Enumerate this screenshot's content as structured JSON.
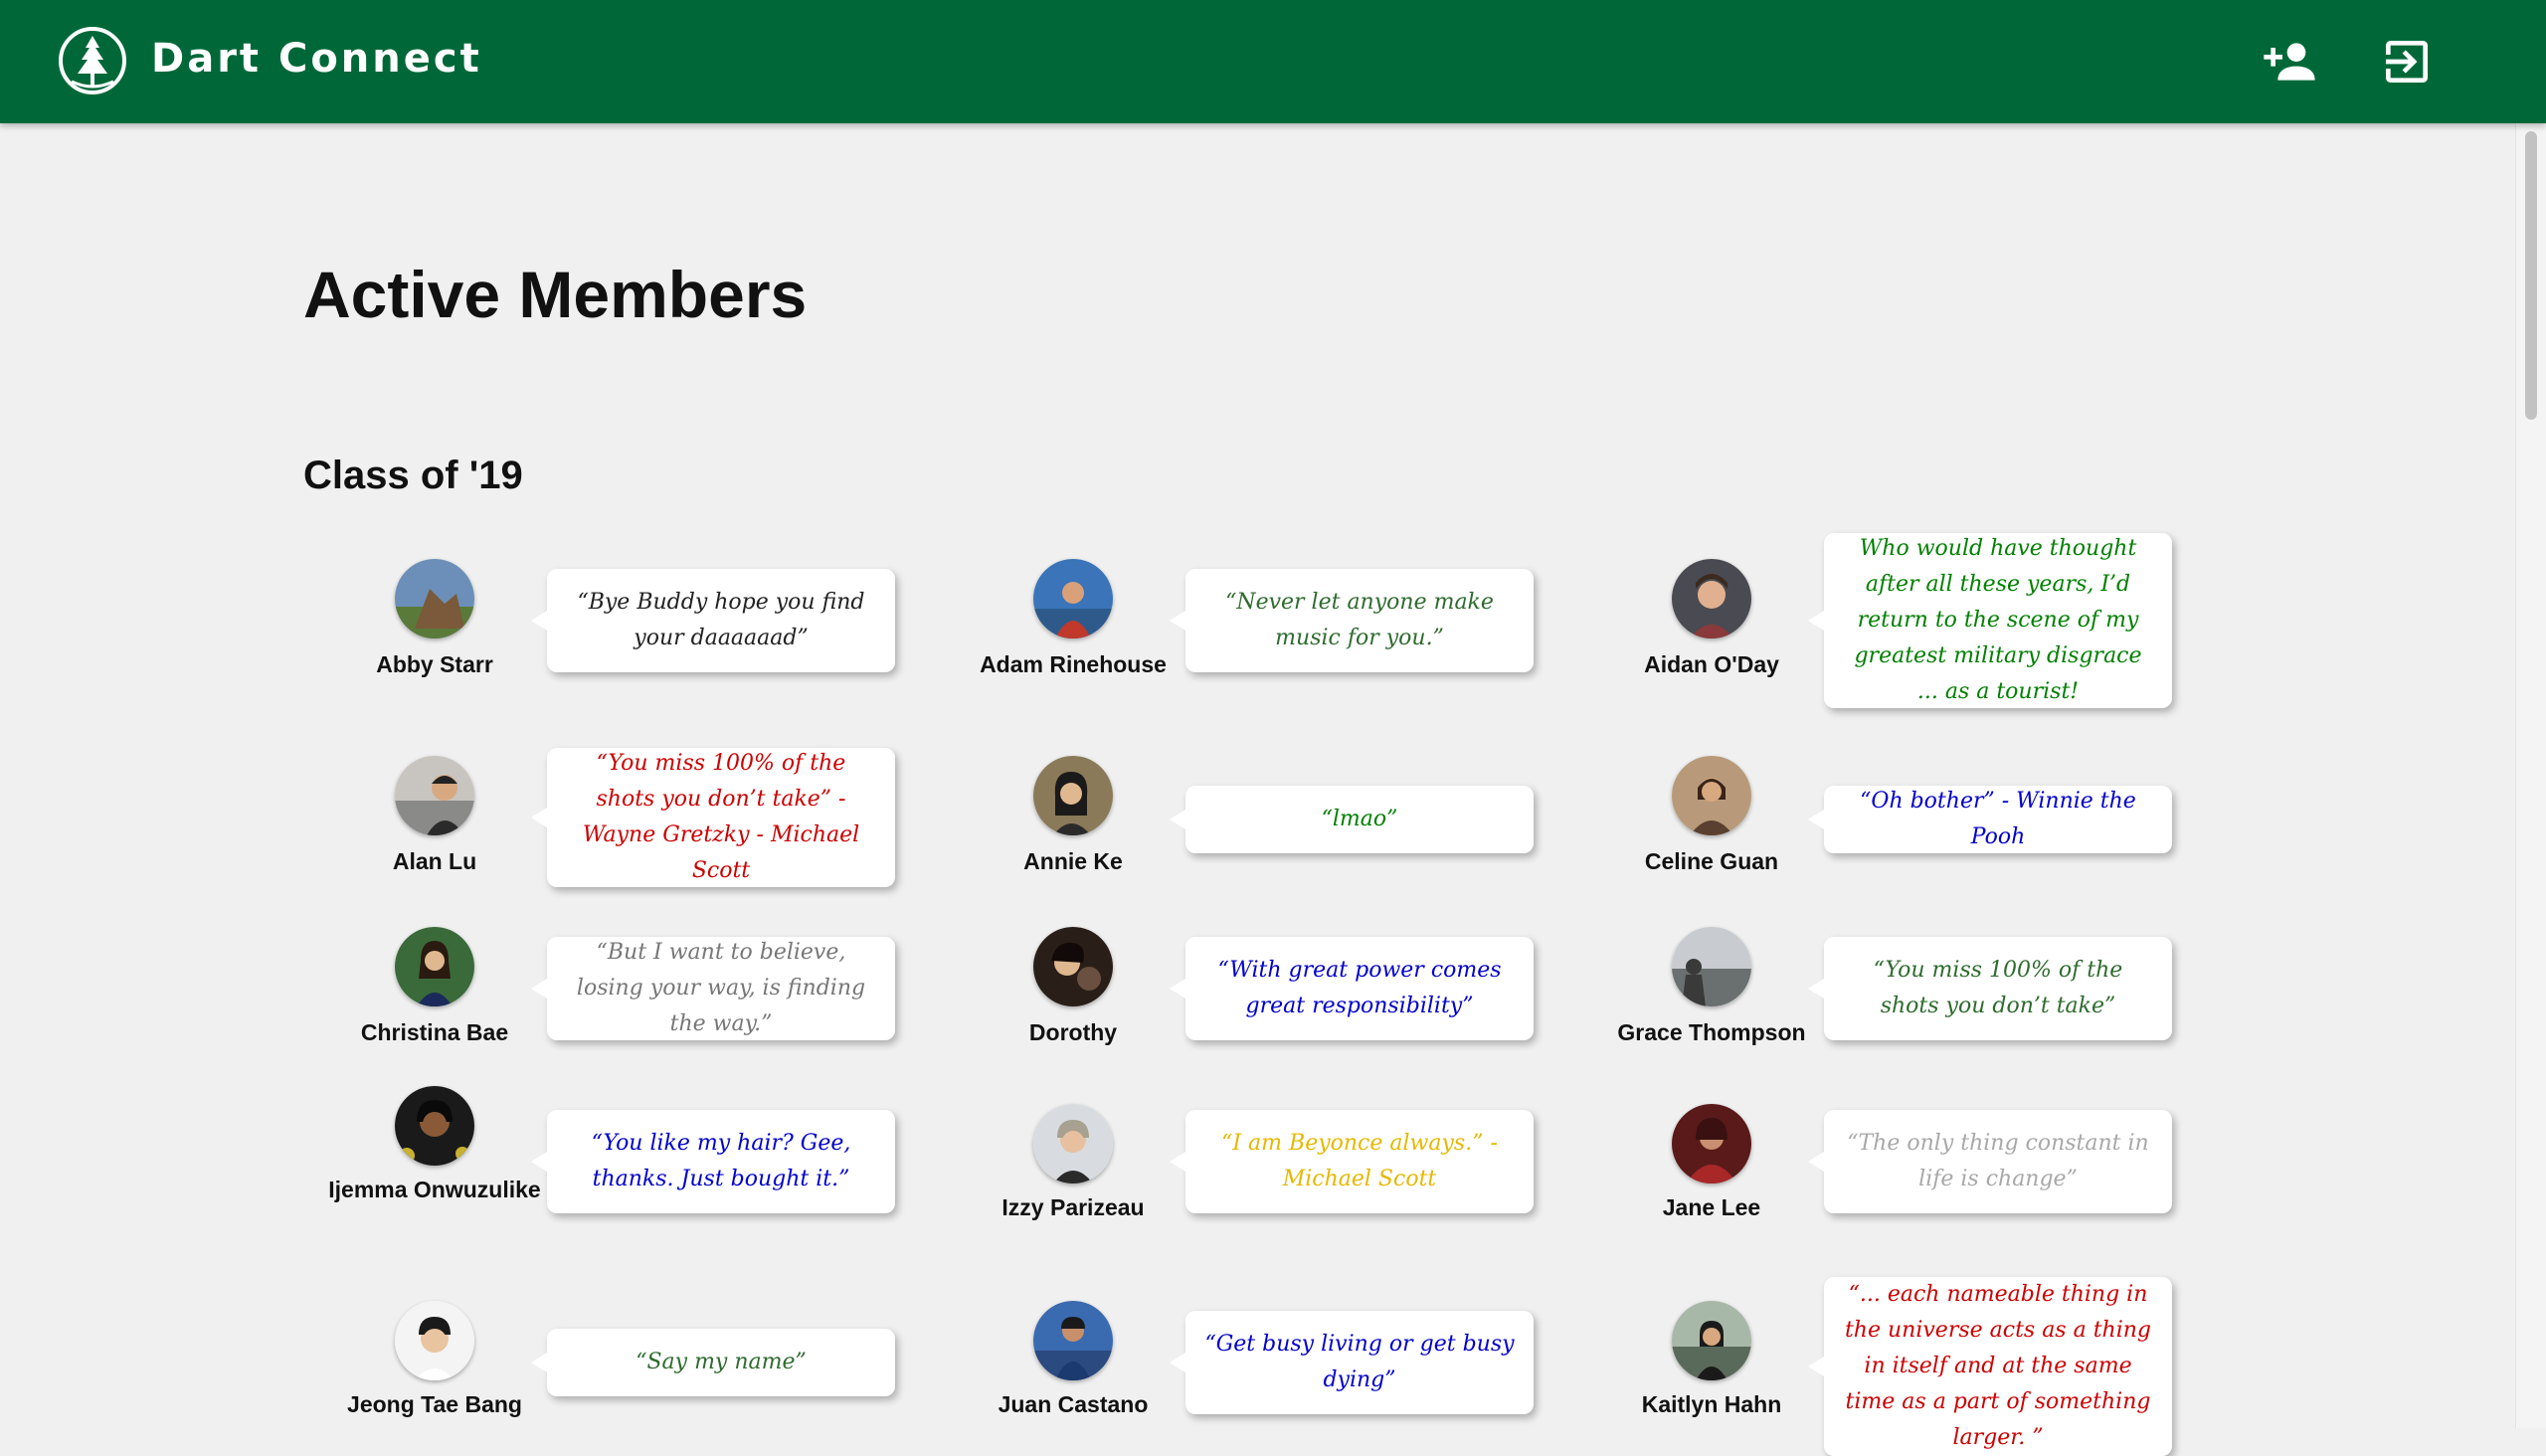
{
  "header": {
    "brand": "Dart Connect",
    "logo_icon": "pine-tree-icon",
    "actions": [
      {
        "icon": "add-person-icon"
      },
      {
        "icon": "logout-icon"
      }
    ],
    "color": "#006838"
  },
  "page": {
    "title": "Active Members",
    "section_title": "Class of '19"
  },
  "members": [
    {
      "name": "Abby Starr",
      "quote": "“Bye Buddy hope you find your daaaaaad”",
      "quote_color": "#222222"
    },
    {
      "name": "Adam Rinehouse",
      "quote": "“Never let anyone make music for you.”",
      "quote_color": "#2e6b2e"
    },
    {
      "name": "Aidan O'Day",
      "quote": "Who would have thought after all these years, I’d return to the scene of my greatest military disgrace ... as a tourist!",
      "quote_color": "#008000"
    },
    {
      "name": "Alan Lu",
      "quote": "“You miss 100% of the shots you don’t take” - Wayne Gretzky - Michael Scott",
      "quote_color": "#cc0000"
    },
    {
      "name": "Annie Ke",
      "quote": "“lmao”",
      "quote_color": "#008000"
    },
    {
      "name": "Celine Guan",
      "quote": "“Oh bother” - Winnie the Pooh",
      "quote_color": "#0000cc"
    },
    {
      "name": "Christina Bae",
      "quote": "“But I want to believe, losing your way, is finding the way.”",
      "quote_color": "#777777"
    },
    {
      "name": "Dorothy",
      "quote": "“With great power comes great responsibility”",
      "quote_color": "#0000cc"
    },
    {
      "name": "Grace Thompson",
      "quote": "“You miss 100% of the shots you don’t take”",
      "quote_color": "#2e6b2e"
    },
    {
      "name": "Ijemma Onwuzulike",
      "quote": "“You like my hair? Gee, thanks. Just bought it.”",
      "quote_color": "#0000cc"
    },
    {
      "name": "Izzy Parizeau",
      "quote": "“I am Beyonce always.” - Michael Scott",
      "quote_color": "#e6b800"
    },
    {
      "name": "Jane Lee",
      "quote": "“The only thing constant in life is change”",
      "quote_color": "#a8a8a8"
    },
    {
      "name": "Jeong Tae Bang",
      "quote": "“Say my name”",
      "quote_color": "#2e6b2e"
    },
    {
      "name": "Juan Castano",
      "quote": "“Get busy living or get busy dying”",
      "quote_color": "#0000cc"
    },
    {
      "name": "Kaitlyn Hahn",
      "quote": "“... each nameable thing in the universe acts as a thing in itself and at the same time as a part of something larger. ”",
      "quote_color": "#cc0000"
    }
  ]
}
